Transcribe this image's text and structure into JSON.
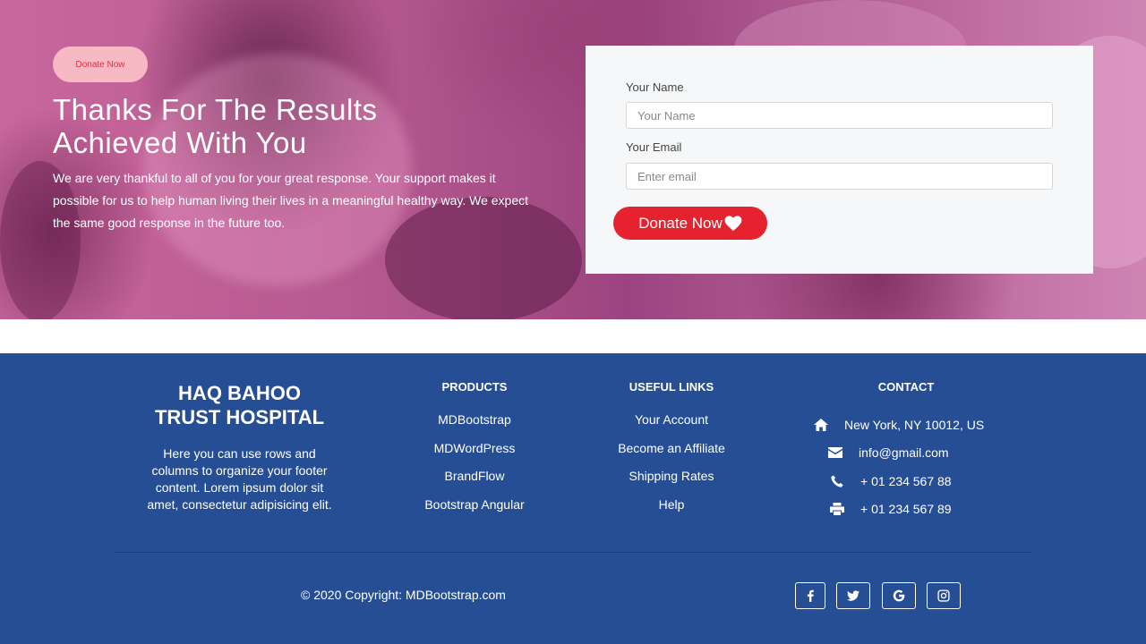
{
  "hero": {
    "badge_label": "Donate Now",
    "title_line1": "Thanks For The Results",
    "title_line2": "Achieved With You",
    "text": "We are very thankful to all of you for your great response. Your support makes it possible for us to help human living their lives in a meaningful healthy way. We expect the same good response in the future too."
  },
  "form": {
    "name_label": "Your Name",
    "name_placeholder": "Your Name",
    "email_label": "Your Email",
    "email_placeholder": "Enter email",
    "submit_label": "Donate Now",
    "submit_icon": "heart-icon"
  },
  "footer": {
    "org_name_line1": "HAQ BAHOO",
    "org_name_line2": "TRUST HOSPITAL",
    "org_text": "Here you can use rows and columns to organize your footer content. Lorem ipsum dolor sit amet, consectetur adipisicing elit.",
    "products": {
      "heading": "PRODUCTS",
      "items": [
        "MDBootstrap",
        "MDWordPress",
        "BrandFlow",
        "Bootstrap Angular"
      ]
    },
    "useful_links": {
      "heading": "USEFUL LINKS",
      "items": [
        "Your Account",
        "Become an Affiliate",
        "Shipping Rates",
        "Help"
      ]
    },
    "contact": {
      "heading": "CONTACT",
      "items": [
        {
          "icon": "home-icon",
          "text": "New York, NY 10012, US"
        },
        {
          "icon": "envelope-icon",
          "text": "info@gmail.com"
        },
        {
          "icon": "phone-icon",
          "text": "+ 01 234 567 88"
        },
        {
          "icon": "print-icon",
          "text": "+ 01 234 567 89"
        }
      ]
    },
    "copyright": "© 2020 Copyright: MDBootstrap.com",
    "social": [
      "facebook-icon",
      "twitter-icon",
      "google-icon",
      "instagram-icon"
    ]
  },
  "colors": {
    "footer_bg": "#264e94",
    "accent_red": "#e5222e",
    "badge_bg": "#f7b9c4",
    "hero_tint": "#b75a91"
  }
}
